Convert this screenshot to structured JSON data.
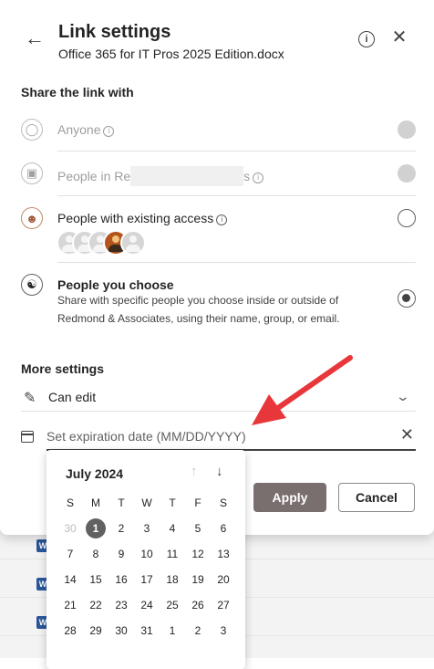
{
  "header": {
    "title": "Link settings",
    "subtitle": "Office 365 for IT Pros 2025 Edition.docx"
  },
  "share": {
    "heading": "Share the link with",
    "options": [
      {
        "label": "Anyone",
        "state": "disabled"
      },
      {
        "label_prefix": "People in Re",
        "label_suffix": "s",
        "state": "disabled"
      },
      {
        "label": "People with existing access",
        "state": "unselected"
      },
      {
        "label": "People you choose",
        "description": "Share with specific people you choose inside or outside of Redmond & Associates, using their name, group, or email.",
        "state": "selected"
      }
    ]
  },
  "more_settings": {
    "heading": "More settings",
    "permission": "Can edit",
    "expiration_placeholder": "Set expiration date (MM/DD/YYYY)"
  },
  "buttons": {
    "apply": "Apply",
    "cancel": "Cancel"
  },
  "calendar": {
    "month": "July 2024",
    "weekdays": [
      "S",
      "M",
      "T",
      "W",
      "T",
      "F",
      "S"
    ],
    "weeks": [
      [
        "30",
        "1",
        "2",
        "3",
        "4",
        "5",
        "6"
      ],
      [
        "7",
        "8",
        "9",
        "10",
        "11",
        "12",
        "13"
      ],
      [
        "14",
        "15",
        "16",
        "17",
        "18",
        "19",
        "20"
      ],
      [
        "21",
        "22",
        "23",
        "24",
        "25",
        "26",
        "27"
      ],
      [
        "28",
        "29",
        "30",
        "31",
        "1",
        "2",
        "3"
      ]
    ],
    "selected": "1"
  },
  "colors": {
    "accent_arrow": "#e8373b",
    "apply_bg": "#7a6f6f"
  }
}
